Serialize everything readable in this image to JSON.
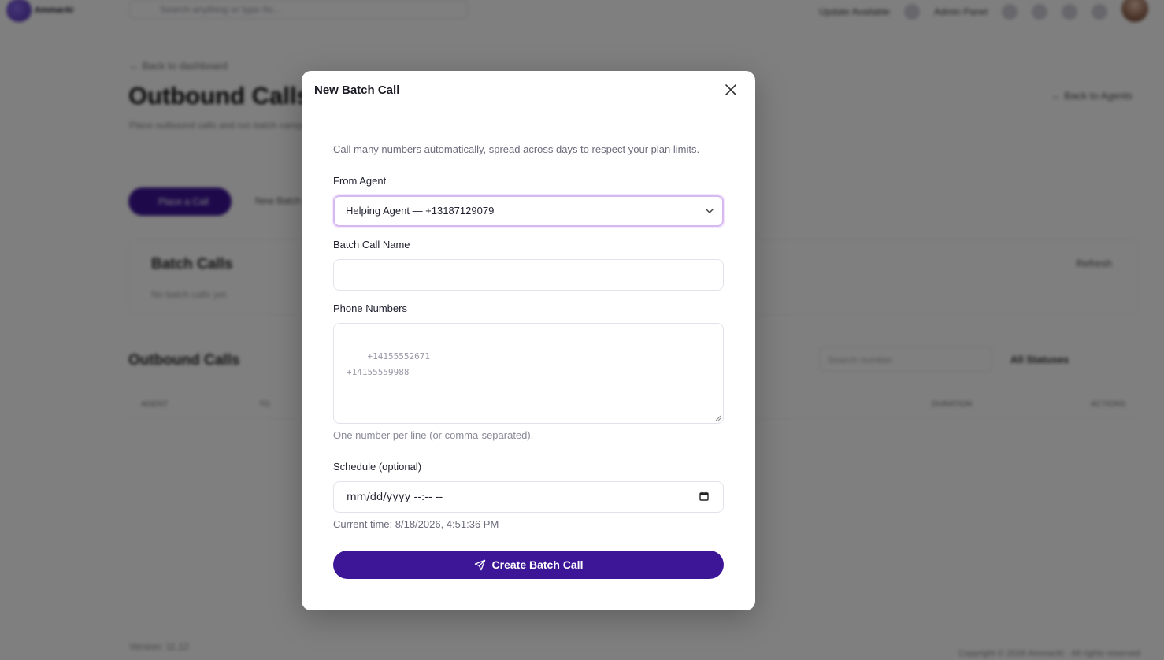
{
  "app": {
    "brand": "AmmarAI",
    "search_placeholder": "Search anything or type /to...",
    "update_label": "Update Available",
    "admin_label": "Admin Panel"
  },
  "page": {
    "back_link": "← Back to dashboard",
    "title": "Outbound Calls",
    "subtitle": "Place outbound calls and run batch campaigns",
    "back_agents": "← Back to Agents",
    "place_call": "Place a Call",
    "new_batch": "New Batch",
    "batch_calls_title": "Batch Calls",
    "batch_empty": "No batch calls yet.",
    "refresh": "Refresh",
    "outbound_title": "Outbound Calls",
    "search_number_placeholder": "Search number",
    "status_filter": "All Statuses",
    "table_headers": [
      "AGENT",
      "TO",
      "DURATION",
      "ACTIONS"
    ],
    "version": "Version: 11.12",
    "copyright": "Copyright © 2026 AmmarAI · All rights reserved"
  },
  "modal": {
    "title": "New Batch Call",
    "description": "Call many numbers automatically, spread across days to respect your plan limits.",
    "from_agent_label": "From Agent",
    "from_agent_value": "Helping Agent — +13187129079",
    "batch_name_label": "Batch Call Name",
    "batch_name_value": "",
    "phone_label": "Phone Numbers",
    "phone_placeholder": "+14155552671\n+14155559988",
    "phone_hint": "One number per line (or comma-separated).",
    "schedule_label": "Schedule (optional)",
    "schedule_value": "mm/dd/yyyy --:-- --",
    "current_time": "Current time: 8/18/2026, 4:51:36 PM",
    "submit_label": "Create Batch Call"
  },
  "colors": {
    "primary": "#3d1597",
    "focus_border": "#d8b8f0",
    "overlay": "rgba(0,0,0,0.5)"
  },
  "icons": {
    "close": "close-icon",
    "chevron": "chevron-down-icon",
    "calendar": "calendar-icon",
    "send": "send-icon"
  }
}
